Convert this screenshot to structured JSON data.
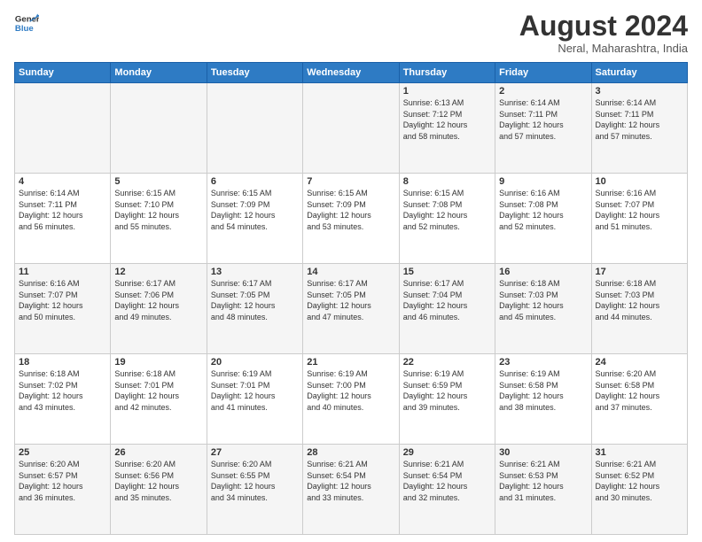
{
  "header": {
    "logo_line1": "General",
    "logo_line2": "Blue",
    "main_title": "August 2024",
    "subtitle": "Neral, Maharashtra, India"
  },
  "days_of_week": [
    "Sunday",
    "Monday",
    "Tuesday",
    "Wednesday",
    "Thursday",
    "Friday",
    "Saturday"
  ],
  "weeks": [
    [
      {
        "day": "",
        "info": ""
      },
      {
        "day": "",
        "info": ""
      },
      {
        "day": "",
        "info": ""
      },
      {
        "day": "",
        "info": ""
      },
      {
        "day": "1",
        "info": "Sunrise: 6:13 AM\nSunset: 7:12 PM\nDaylight: 12 hours\nand 58 minutes."
      },
      {
        "day": "2",
        "info": "Sunrise: 6:14 AM\nSunset: 7:11 PM\nDaylight: 12 hours\nand 57 minutes."
      },
      {
        "day": "3",
        "info": "Sunrise: 6:14 AM\nSunset: 7:11 PM\nDaylight: 12 hours\nand 57 minutes."
      }
    ],
    [
      {
        "day": "4",
        "info": "Sunrise: 6:14 AM\nSunset: 7:11 PM\nDaylight: 12 hours\nand 56 minutes."
      },
      {
        "day": "5",
        "info": "Sunrise: 6:15 AM\nSunset: 7:10 PM\nDaylight: 12 hours\nand 55 minutes."
      },
      {
        "day": "6",
        "info": "Sunrise: 6:15 AM\nSunset: 7:09 PM\nDaylight: 12 hours\nand 54 minutes."
      },
      {
        "day": "7",
        "info": "Sunrise: 6:15 AM\nSunset: 7:09 PM\nDaylight: 12 hours\nand 53 minutes."
      },
      {
        "day": "8",
        "info": "Sunrise: 6:15 AM\nSunset: 7:08 PM\nDaylight: 12 hours\nand 52 minutes."
      },
      {
        "day": "9",
        "info": "Sunrise: 6:16 AM\nSunset: 7:08 PM\nDaylight: 12 hours\nand 52 minutes."
      },
      {
        "day": "10",
        "info": "Sunrise: 6:16 AM\nSunset: 7:07 PM\nDaylight: 12 hours\nand 51 minutes."
      }
    ],
    [
      {
        "day": "11",
        "info": "Sunrise: 6:16 AM\nSunset: 7:07 PM\nDaylight: 12 hours\nand 50 minutes."
      },
      {
        "day": "12",
        "info": "Sunrise: 6:17 AM\nSunset: 7:06 PM\nDaylight: 12 hours\nand 49 minutes."
      },
      {
        "day": "13",
        "info": "Sunrise: 6:17 AM\nSunset: 7:05 PM\nDaylight: 12 hours\nand 48 minutes."
      },
      {
        "day": "14",
        "info": "Sunrise: 6:17 AM\nSunset: 7:05 PM\nDaylight: 12 hours\nand 47 minutes."
      },
      {
        "day": "15",
        "info": "Sunrise: 6:17 AM\nSunset: 7:04 PM\nDaylight: 12 hours\nand 46 minutes."
      },
      {
        "day": "16",
        "info": "Sunrise: 6:18 AM\nSunset: 7:03 PM\nDaylight: 12 hours\nand 45 minutes."
      },
      {
        "day": "17",
        "info": "Sunrise: 6:18 AM\nSunset: 7:03 PM\nDaylight: 12 hours\nand 44 minutes."
      }
    ],
    [
      {
        "day": "18",
        "info": "Sunrise: 6:18 AM\nSunset: 7:02 PM\nDaylight: 12 hours\nand 43 minutes."
      },
      {
        "day": "19",
        "info": "Sunrise: 6:18 AM\nSunset: 7:01 PM\nDaylight: 12 hours\nand 42 minutes."
      },
      {
        "day": "20",
        "info": "Sunrise: 6:19 AM\nSunset: 7:01 PM\nDaylight: 12 hours\nand 41 minutes."
      },
      {
        "day": "21",
        "info": "Sunrise: 6:19 AM\nSunset: 7:00 PM\nDaylight: 12 hours\nand 40 minutes."
      },
      {
        "day": "22",
        "info": "Sunrise: 6:19 AM\nSunset: 6:59 PM\nDaylight: 12 hours\nand 39 minutes."
      },
      {
        "day": "23",
        "info": "Sunrise: 6:19 AM\nSunset: 6:58 PM\nDaylight: 12 hours\nand 38 minutes."
      },
      {
        "day": "24",
        "info": "Sunrise: 6:20 AM\nSunset: 6:58 PM\nDaylight: 12 hours\nand 37 minutes."
      }
    ],
    [
      {
        "day": "25",
        "info": "Sunrise: 6:20 AM\nSunset: 6:57 PM\nDaylight: 12 hours\nand 36 minutes."
      },
      {
        "day": "26",
        "info": "Sunrise: 6:20 AM\nSunset: 6:56 PM\nDaylight: 12 hours\nand 35 minutes."
      },
      {
        "day": "27",
        "info": "Sunrise: 6:20 AM\nSunset: 6:55 PM\nDaylight: 12 hours\nand 34 minutes."
      },
      {
        "day": "28",
        "info": "Sunrise: 6:21 AM\nSunset: 6:54 PM\nDaylight: 12 hours\nand 33 minutes."
      },
      {
        "day": "29",
        "info": "Sunrise: 6:21 AM\nSunset: 6:54 PM\nDaylight: 12 hours\nand 32 minutes."
      },
      {
        "day": "30",
        "info": "Sunrise: 6:21 AM\nSunset: 6:53 PM\nDaylight: 12 hours\nand 31 minutes."
      },
      {
        "day": "31",
        "info": "Sunrise: 6:21 AM\nSunset: 6:52 PM\nDaylight: 12 hours\nand 30 minutes."
      }
    ]
  ]
}
